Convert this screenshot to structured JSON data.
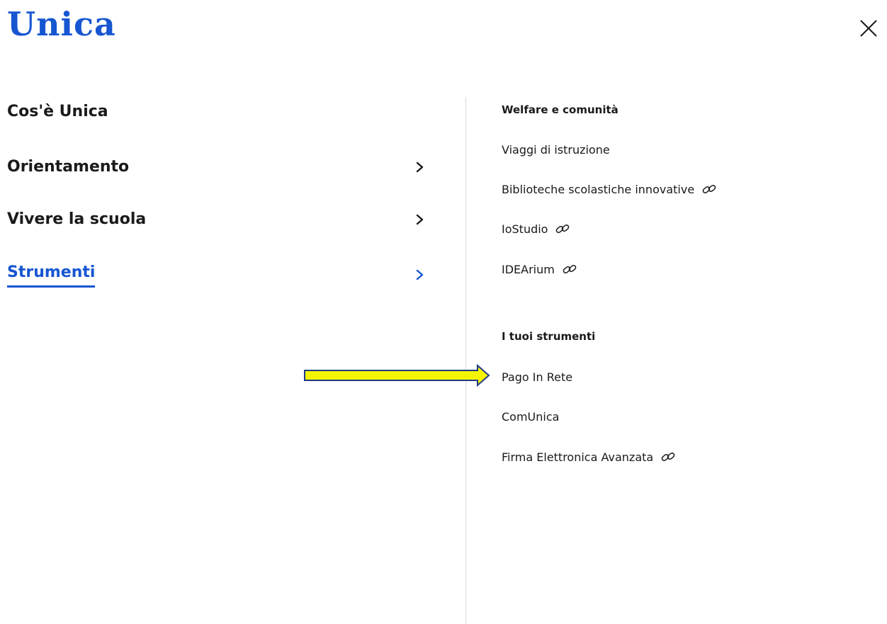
{
  "header": {
    "logo_text": "Unica",
    "close_icon": "close-icon",
    "brand_color": "#1656d1"
  },
  "nav": {
    "items": [
      {
        "label": "Cos'è Unica",
        "has_chevron": false,
        "active": false
      },
      {
        "label": "Orientamento",
        "has_chevron": true,
        "active": false
      },
      {
        "label": "Vivere la scuola",
        "has_chevron": true,
        "active": false
      },
      {
        "label": "Strumenti",
        "has_chevron": true,
        "active": true
      }
    ]
  },
  "submenu": {
    "sections": [
      {
        "title": "Welfare e comunità",
        "items": [
          {
            "label": "Viaggi di istruzione",
            "external": false
          },
          {
            "label": "Biblioteche scolastiche innovative",
            "external": true
          },
          {
            "label": "IoStudio",
            "external": true
          },
          {
            "label": "IDEArium",
            "external": true
          }
        ]
      },
      {
        "title": "I tuoi strumenti",
        "items": [
          {
            "label": "Pago In Rete",
            "external": false
          },
          {
            "label": "ComUnica",
            "external": false
          },
          {
            "label": "Firma Elettronica Avanzata",
            "external": true
          }
        ]
      }
    ]
  },
  "annotation": {
    "arrow_color": "#f5f500",
    "arrow_outline": "#1f3a8a",
    "points_to": "Pago In Rete"
  }
}
